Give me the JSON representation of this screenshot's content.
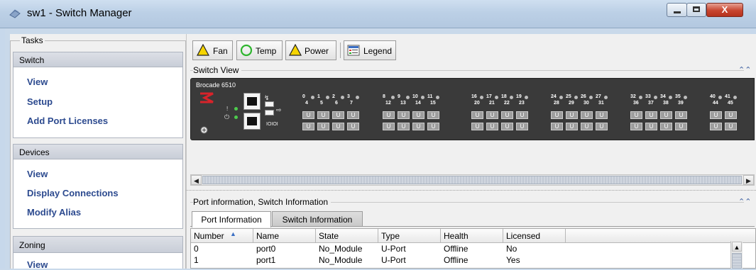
{
  "window": {
    "title": "sw1 - Switch Manager",
    "controls": {
      "minimize": "minimize",
      "maximize": "maximize",
      "close": "X"
    }
  },
  "tasks": {
    "title": "Tasks",
    "sections": [
      {
        "header": "Switch",
        "items": [
          "View",
          "Setup",
          "Add Port Licenses"
        ]
      },
      {
        "header": "Devices",
        "items": [
          "View",
          "Display Connections",
          "Modify Alias"
        ]
      },
      {
        "header": "Zoning",
        "items": [
          "View"
        ]
      }
    ]
  },
  "toolbar": {
    "fan": "Fan",
    "temp": "Temp",
    "power": "Power",
    "legend": "Legend"
  },
  "switch_view": {
    "title": "Switch View",
    "model": "Brocade 6510",
    "console_label": "IOIOI",
    "port_top_labels": [
      "0",
      "1",
      "2",
      "3",
      "8",
      "9",
      "10",
      "11",
      "16",
      "17",
      "18",
      "19",
      "24",
      "25",
      "26",
      "27",
      "32",
      "33",
      "34",
      "35",
      "40",
      "41"
    ],
    "port_bottom_labels": [
      "4",
      "5",
      "6",
      "7",
      "12",
      "13",
      "14",
      "15",
      "20",
      "21",
      "22",
      "23",
      "28",
      "29",
      "30",
      "31",
      "36",
      "37",
      "38",
      "39",
      "44",
      "45"
    ],
    "port_state": "U"
  },
  "info": {
    "title": "Port information, Switch Information",
    "tabs": [
      "Port Information",
      "Switch Information"
    ],
    "active_tab": "Port Information",
    "columns": [
      "Number",
      "Name",
      "State",
      "Type",
      "Health",
      "Licensed"
    ],
    "rows": [
      [
        "0",
        "port0",
        "No_Module",
        "U-Port",
        "Offline",
        "No"
      ],
      [
        "1",
        "port1",
        "No_Module",
        "U-Port",
        "Offline",
        "Yes"
      ]
    ]
  },
  "colors": {
    "link": "#2c4a8f",
    "warning_icon": "#f5d400",
    "ok_icon": "#2fb52f",
    "chassis": "#3a3a3a",
    "logo_red": "#d8232a"
  }
}
